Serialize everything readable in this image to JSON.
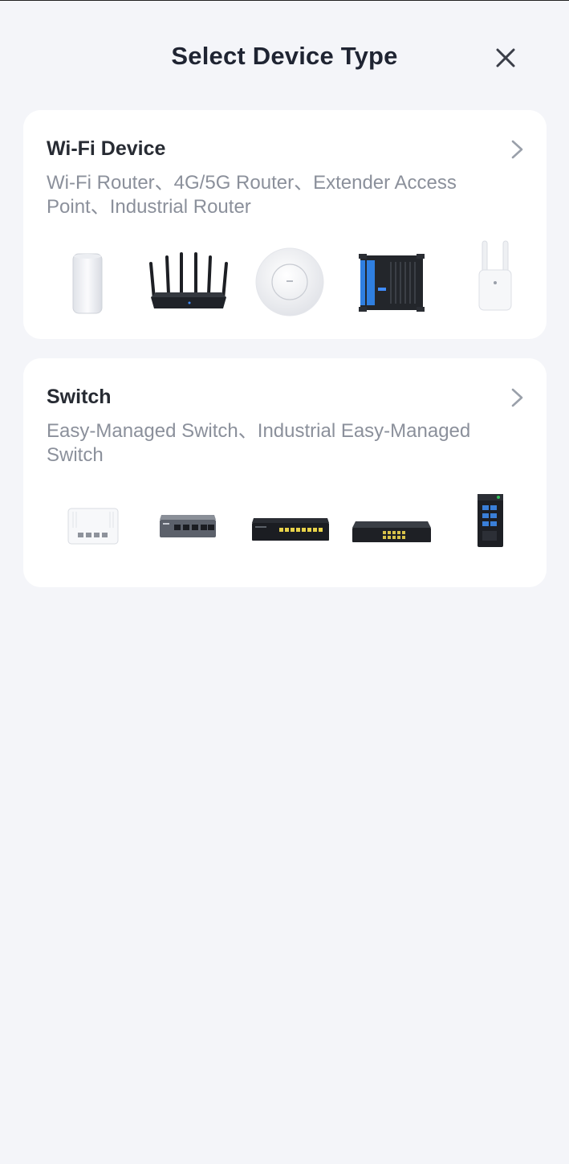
{
  "header": {
    "title": "Select Device Type",
    "close_icon": "close-icon"
  },
  "cards": [
    {
      "title": "Wi-Fi Device",
      "description": "Wi-Fi Router、4G/5G Router、Extender Access Point、Industrial Router",
      "chevron_icon": "chevron-right-icon",
      "images": [
        "mesh-router-image",
        "wifi-router-image",
        "ceiling-access-point-image",
        "industrial-router-image",
        "range-extender-image"
      ]
    },
    {
      "title": "Switch",
      "description": "Easy-Managed Switch、Industrial Easy-Managed Switch",
      "chevron_icon": "chevron-right-icon",
      "images": [
        "wall-plate-switch-image",
        "desktop-switch-image",
        "poe-switch-image",
        "rackmount-switch-image",
        "industrial-switch-image"
      ]
    }
  ],
  "colors": {
    "background": "#f4f5f9",
    "card": "#ffffff",
    "title": "#1f2432",
    "description": "#8b909b",
    "accent_blue": "#2f7fe0"
  }
}
